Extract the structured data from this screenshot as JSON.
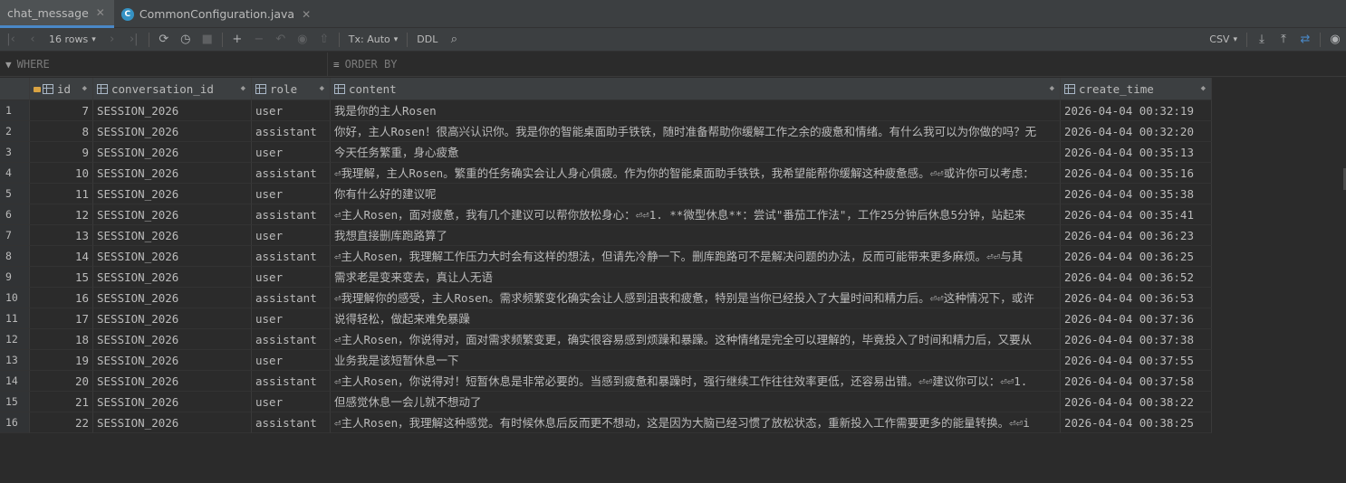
{
  "tabs": [
    {
      "label": "chat_message",
      "icon": "table-icon",
      "active": true
    },
    {
      "label": "CommonConfiguration.java",
      "icon": "java-class-icon",
      "active": false
    }
  ],
  "toolbar": {
    "rows_label": "16 rows",
    "tx_label": "Tx: Auto",
    "ddl_label": "DDL",
    "export_label": "CSV"
  },
  "filter": {
    "where_placeholder": "WHERE",
    "order_placeholder": "ORDER BY"
  },
  "columns": [
    "id",
    "conversation_id",
    "role",
    "content",
    "create_time"
  ],
  "rows": [
    {
      "n": "1",
      "id": "7",
      "conv": "SESSION_2026",
      "role": "user",
      "content": "我是你的主人Rosen",
      "time": "2026-04-04 00:32:19"
    },
    {
      "n": "2",
      "id": "8",
      "conv": "SESSION_2026",
      "role": "assistant",
      "content": "你好，主人Rosen！很高兴认识你。我是你的智能桌面助手铁铁，随时准备帮助你缓解工作之余的疲惫和情绪。有什么我可以为你做的吗？无",
      "time": "2026-04-04 00:32:20"
    },
    {
      "n": "3",
      "id": "9",
      "conv": "SESSION_2026",
      "role": "user",
      "content": "今天任务繁重，身心疲惫",
      "time": "2026-04-04 00:35:13"
    },
    {
      "n": "4",
      "id": "10",
      "conv": "SESSION_2026",
      "role": "assistant",
      "content": "⏎我理解，主人Rosen。繁重的任务确实会让人身心俱疲。作为你的智能桌面助手铁铁，我希望能帮你缓解这种疲惫感。⏎⏎或许你可以考虑：",
      "time": "2026-04-04 00:35:16"
    },
    {
      "n": "5",
      "id": "11",
      "conv": "SESSION_2026",
      "role": "user",
      "content": "你有什么好的建议呢",
      "time": "2026-04-04 00:35:38"
    },
    {
      "n": "6",
      "id": "12",
      "conv": "SESSION_2026",
      "role": "assistant",
      "content": "⏎主人Rosen，面对疲惫，我有几个建议可以帮你放松身心：⏎⏎1. **微型休息**：尝试\"番茄工作法\"，工作25分钟后休息5分钟，站起来",
      "time": "2026-04-04 00:35:41"
    },
    {
      "n": "7",
      "id": "13",
      "conv": "SESSION_2026",
      "role": "user",
      "content": "我想直接删库跑路算了",
      "time": "2026-04-04 00:36:23"
    },
    {
      "n": "8",
      "id": "14",
      "conv": "SESSION_2026",
      "role": "assistant",
      "content": "⏎主人Rosen，我理解工作压力大时会有这样的想法，但请先冷静一下。删库跑路可不是解决问题的办法，反而可能带来更多麻烦。⏎⏎与其",
      "time": "2026-04-04 00:36:25"
    },
    {
      "n": "9",
      "id": "15",
      "conv": "SESSION_2026",
      "role": "user",
      "content": "需求老是变来变去，真让人无语",
      "time": "2026-04-04 00:36:52"
    },
    {
      "n": "10",
      "id": "16",
      "conv": "SESSION_2026",
      "role": "assistant",
      "content": "⏎我理解你的感受，主人Rosen。需求频繁变化确实会让人感到沮丧和疲惫，特别是当你已经投入了大量时间和精力后。⏎⏎这种情况下，或许",
      "time": "2026-04-04 00:36:53"
    },
    {
      "n": "11",
      "id": "17",
      "conv": "SESSION_2026",
      "role": "user",
      "content": "说得轻松，做起来难免暴躁",
      "time": "2026-04-04 00:37:36"
    },
    {
      "n": "12",
      "id": "18",
      "conv": "SESSION_2026",
      "role": "assistant",
      "content": "⏎主人Rosen，你说得对，面对需求频繁变更，确实很容易感到烦躁和暴躁。这种情绪是完全可以理解的，毕竟投入了时间和精力后，又要从",
      "time": "2026-04-04 00:37:38"
    },
    {
      "n": "13",
      "id": "19",
      "conv": "SESSION_2026",
      "role": "user",
      "content": "业务我是该短暂休息一下",
      "time": "2026-04-04 00:37:55"
    },
    {
      "n": "14",
      "id": "20",
      "conv": "SESSION_2026",
      "role": "assistant",
      "content": "⏎主人Rosen，你说得对！短暂休息是非常必要的。当感到疲惫和暴躁时，强行继续工作往往效率更低，还容易出错。⏎⏎建议你可以：⏎⏎1.",
      "time": "2026-04-04 00:37:58"
    },
    {
      "n": "15",
      "id": "21",
      "conv": "SESSION_2026",
      "role": "user",
      "content": "但感觉休息一会儿就不想动了",
      "time": "2026-04-04 00:38:22"
    },
    {
      "n": "16",
      "id": "22",
      "conv": "SESSION_2026",
      "role": "assistant",
      "content": "⏎主人Rosen，我理解这种感觉。有时候休息后反而更不想动，这是因为大脑已经习惯了放松状态，重新投入工作需要更多的能量转换。⏎⏎i",
      "time": "2026-04-04 00:38:25"
    }
  ]
}
